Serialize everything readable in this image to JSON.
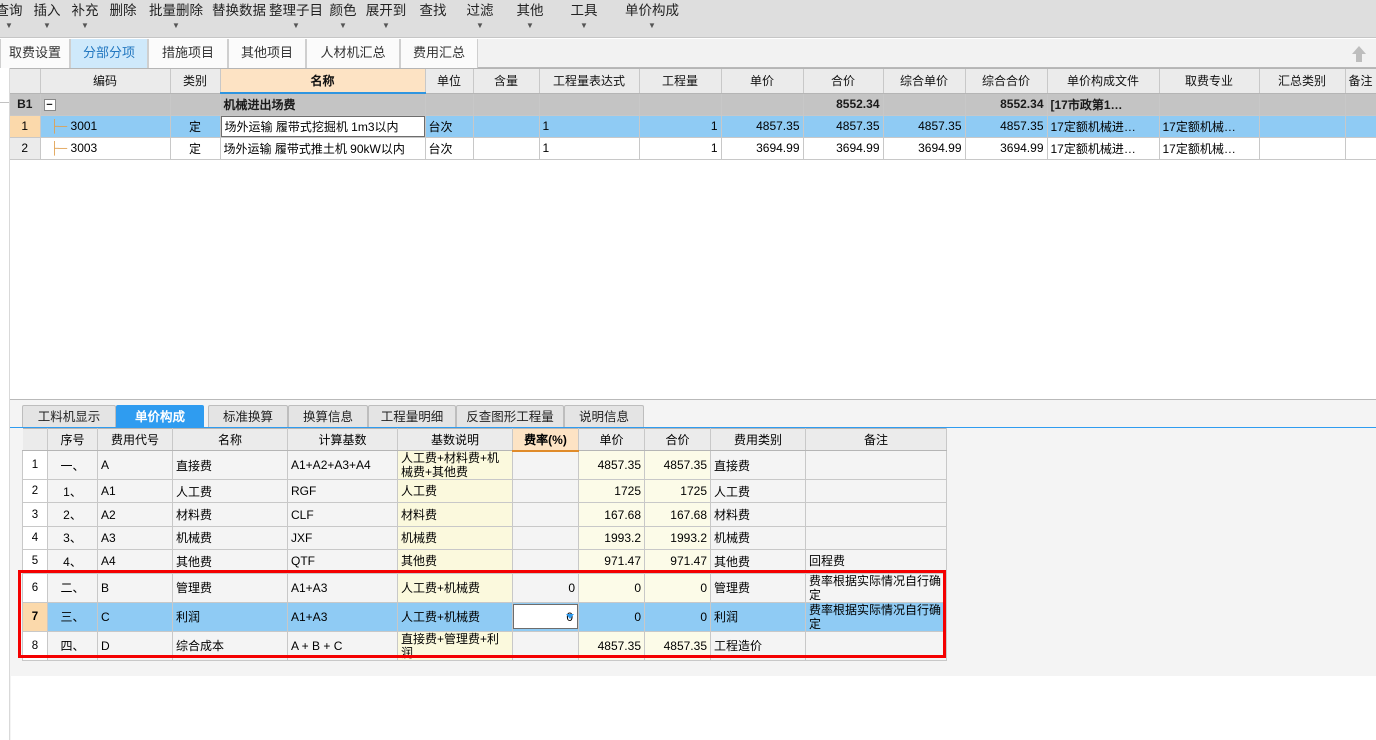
{
  "menu": {
    "items": [
      {
        "label": "查询",
        "caret": true
      },
      {
        "label": "插入",
        "caret": true
      },
      {
        "label": "补充",
        "caret": true
      },
      {
        "label": "删除",
        "caret": false
      },
      {
        "label": "批量删除",
        "caret": true
      },
      {
        "label": "替换数据",
        "caret": false
      },
      {
        "label": "整理子目",
        "caret": true
      },
      {
        "label": "颜色",
        "caret": true
      },
      {
        "label": "展开到",
        "caret": true
      },
      {
        "label": "查找",
        "caret": false
      },
      {
        "label": "过滤",
        "caret": true
      },
      {
        "label": "其他",
        "caret": true
      },
      {
        "label": "工具",
        "caret": true
      },
      {
        "label": "单价构成",
        "caret": true
      }
    ]
  },
  "tabs": {
    "items": [
      "取费设置",
      "分部分项",
      "措施项目",
      "其他项目",
      "人材机汇总",
      "费用汇总"
    ],
    "active": "分部分项",
    "collapse_icon": "up-arrow-icon"
  },
  "grid": {
    "columns": [
      "",
      "编码",
      "类别",
      "名称",
      "单位",
      "含量",
      "工程量表达式",
      "工程量",
      "单价",
      "合价",
      "综合单价",
      "综合合价",
      "单价构成文件",
      "取费专业",
      "汇总类别",
      "备注"
    ],
    "highlight_column": "名称",
    "rows": [
      {
        "rowhdr": "B1",
        "type": "group",
        "expander": "−",
        "code": "",
        "category": "",
        "name": "机械进出场费",
        "unit": "",
        "content": "",
        "qty_expr": "",
        "qty": "",
        "unit_price": "",
        "total_price": "8552.34",
        "comp_unit_price": "",
        "comp_total_price": "8552.34",
        "price_file": "[17市政第1…",
        "fee_major": "",
        "summary_type": "",
        "remark": ""
      },
      {
        "rowhdr": "1",
        "type": "selected",
        "code": "3001",
        "category": "定",
        "name": "场外运输 履带式挖掘机 1m3以内",
        "name_editing": true,
        "unit": "台次",
        "content": "",
        "qty_expr": "1",
        "qty": "1",
        "unit_price": "4857.35",
        "total_price": "4857.35",
        "comp_unit_price": "4857.35",
        "comp_total_price": "4857.35",
        "price_file": "17定额机械进…",
        "fee_major": "17定额机械…",
        "summary_type": "",
        "remark": ""
      },
      {
        "rowhdr": "2",
        "type": "normal",
        "code": "3003",
        "category": "定",
        "name": "场外运输 履带式推土机 90kW以内",
        "unit": "台次",
        "content": "",
        "qty_expr": "1",
        "qty": "1",
        "unit_price": "3694.99",
        "total_price": "3694.99",
        "comp_unit_price": "3694.99",
        "comp_total_price": "3694.99",
        "price_file": "17定额机械进…",
        "fee_major": "17定额机械…",
        "summary_type": "",
        "remark": ""
      }
    ]
  },
  "lower": {
    "tabs": [
      "工料机显示",
      "单价构成",
      "标准换算",
      "换算信息",
      "工程量明细",
      "反查图形工程量",
      "说明信息"
    ],
    "active_tab": "单价构成",
    "columns": [
      "",
      "序号",
      "费用代号",
      "名称",
      "计算基数",
      "基数说明",
      "费率(%)",
      "单价",
      "合价",
      "费用类别",
      "备注"
    ],
    "highlight_column": "费率(%)",
    "rows": [
      {
        "rowhdr": "1",
        "seq": "一、",
        "code": "A",
        "name": "直接费",
        "base": "A1+A2+A3+A4",
        "base_desc": "人工费+材料费+机械费+其他费",
        "rate": "",
        "unit_price": "4857.35",
        "total_price": "4857.35",
        "fee_type": "直接费",
        "remark": "",
        "state": "normal"
      },
      {
        "rowhdr": "2",
        "seq": "1、",
        "code": "A1",
        "name": "人工费",
        "base": "RGF",
        "base_desc": "人工费",
        "rate": "",
        "unit_price": "1725",
        "total_price": "1725",
        "fee_type": "人工费",
        "remark": "",
        "state": "normal"
      },
      {
        "rowhdr": "3",
        "seq": "2、",
        "code": "A2",
        "name": "材料费",
        "base": "CLF",
        "base_desc": "材料费",
        "rate": "",
        "unit_price": "167.68",
        "total_price": "167.68",
        "fee_type": "材料费",
        "remark": "",
        "state": "normal"
      },
      {
        "rowhdr": "4",
        "seq": "3、",
        "code": "A3",
        "name": "机械费",
        "base": "JXF",
        "base_desc": "机械费",
        "rate": "",
        "unit_price": "1993.2",
        "total_price": "1993.2",
        "fee_type": "机械费",
        "remark": "",
        "state": "normal"
      },
      {
        "rowhdr": "5",
        "seq": "4、",
        "code": "A4",
        "name": "其他费",
        "base": "QTF",
        "base_desc": "其他费",
        "rate": "",
        "unit_price": "971.47",
        "total_price": "971.47",
        "fee_type": "其他费",
        "remark": "回程费",
        "state": "normal"
      },
      {
        "rowhdr": "6",
        "seq": "二、",
        "code": "B",
        "name": "管理费",
        "base": "A1+A3",
        "base_desc": "人工费+机械费",
        "rate": "0",
        "unit_price": "0",
        "total_price": "0",
        "fee_type": "管理费",
        "remark": "费率根据实际情况自行确定",
        "state": "normal"
      },
      {
        "rowhdr": "7",
        "seq": "三、",
        "code": "C",
        "name": "利润",
        "base": "A1+A3",
        "base_desc": "人工费+机械费",
        "rate": "0",
        "rate_editing": true,
        "unit_price": "0",
        "total_price": "0",
        "fee_type": "利润",
        "remark": "费率根据实际情况自行确定",
        "state": "selected"
      },
      {
        "rowhdr": "8",
        "seq": "四、",
        "code": "D",
        "name": "综合成本",
        "base": "A + B + C",
        "base_desc": "直接费+管理费+利润",
        "rate": "",
        "unit_price": "4857.35",
        "total_price": "4857.35",
        "fee_type": "工程造价",
        "remark": "",
        "state": "normal"
      }
    ]
  },
  "annotation": {
    "type": "red-rectangle",
    "color": "#f40000"
  }
}
